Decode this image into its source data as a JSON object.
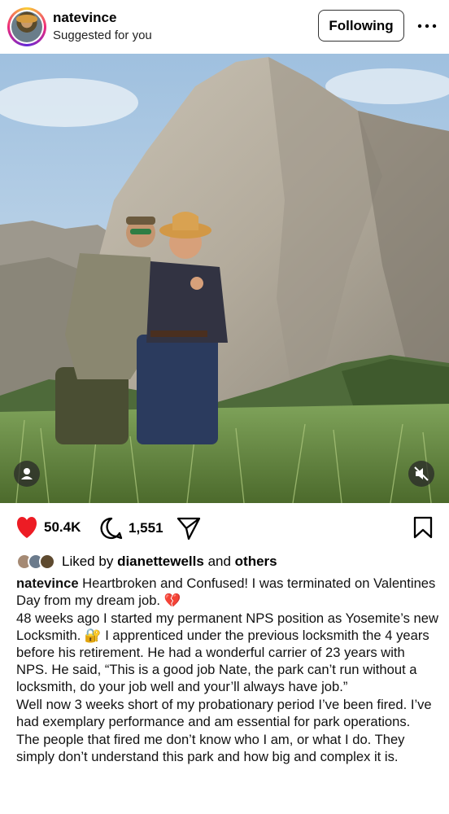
{
  "post": {
    "username": "natevince",
    "subtitle": "Suggested for you",
    "follow_label": "Following",
    "more_icon": "more-horizontal-icon"
  },
  "actions": {
    "likes_count": "50.4K",
    "comments_count": "1,551",
    "like_color": "#ed1c24"
  },
  "liked_by": {
    "prefix": "Liked by",
    "user": "dianettewells",
    "conjunction": "and",
    "others": "others"
  },
  "caption": {
    "username": "natevince",
    "line1": " Heartbroken and Confused!  I was terminated on Valentines Day from my dream job. 💔",
    "para2": "48 weeks ago I started my permanent NPS position as Yosemite’s new Locksmith. 🔐 I apprenticed under the previous locksmith the 4 years before his retirement. He had a wonderful carrier of 23 years with NPS. He said, “This is a good job Nate, the park can’t run without a locksmith, do your job well and your’ll always have job.”",
    "para3": "Well now 3 weeks short of my probationary period I’ve been fired. I’ve had exemplary performance and am essential for park operations.",
    "para4": "The people that fired me don’t know who I am, or what I do. They simply don’t understand this park and how big and complex it is."
  }
}
